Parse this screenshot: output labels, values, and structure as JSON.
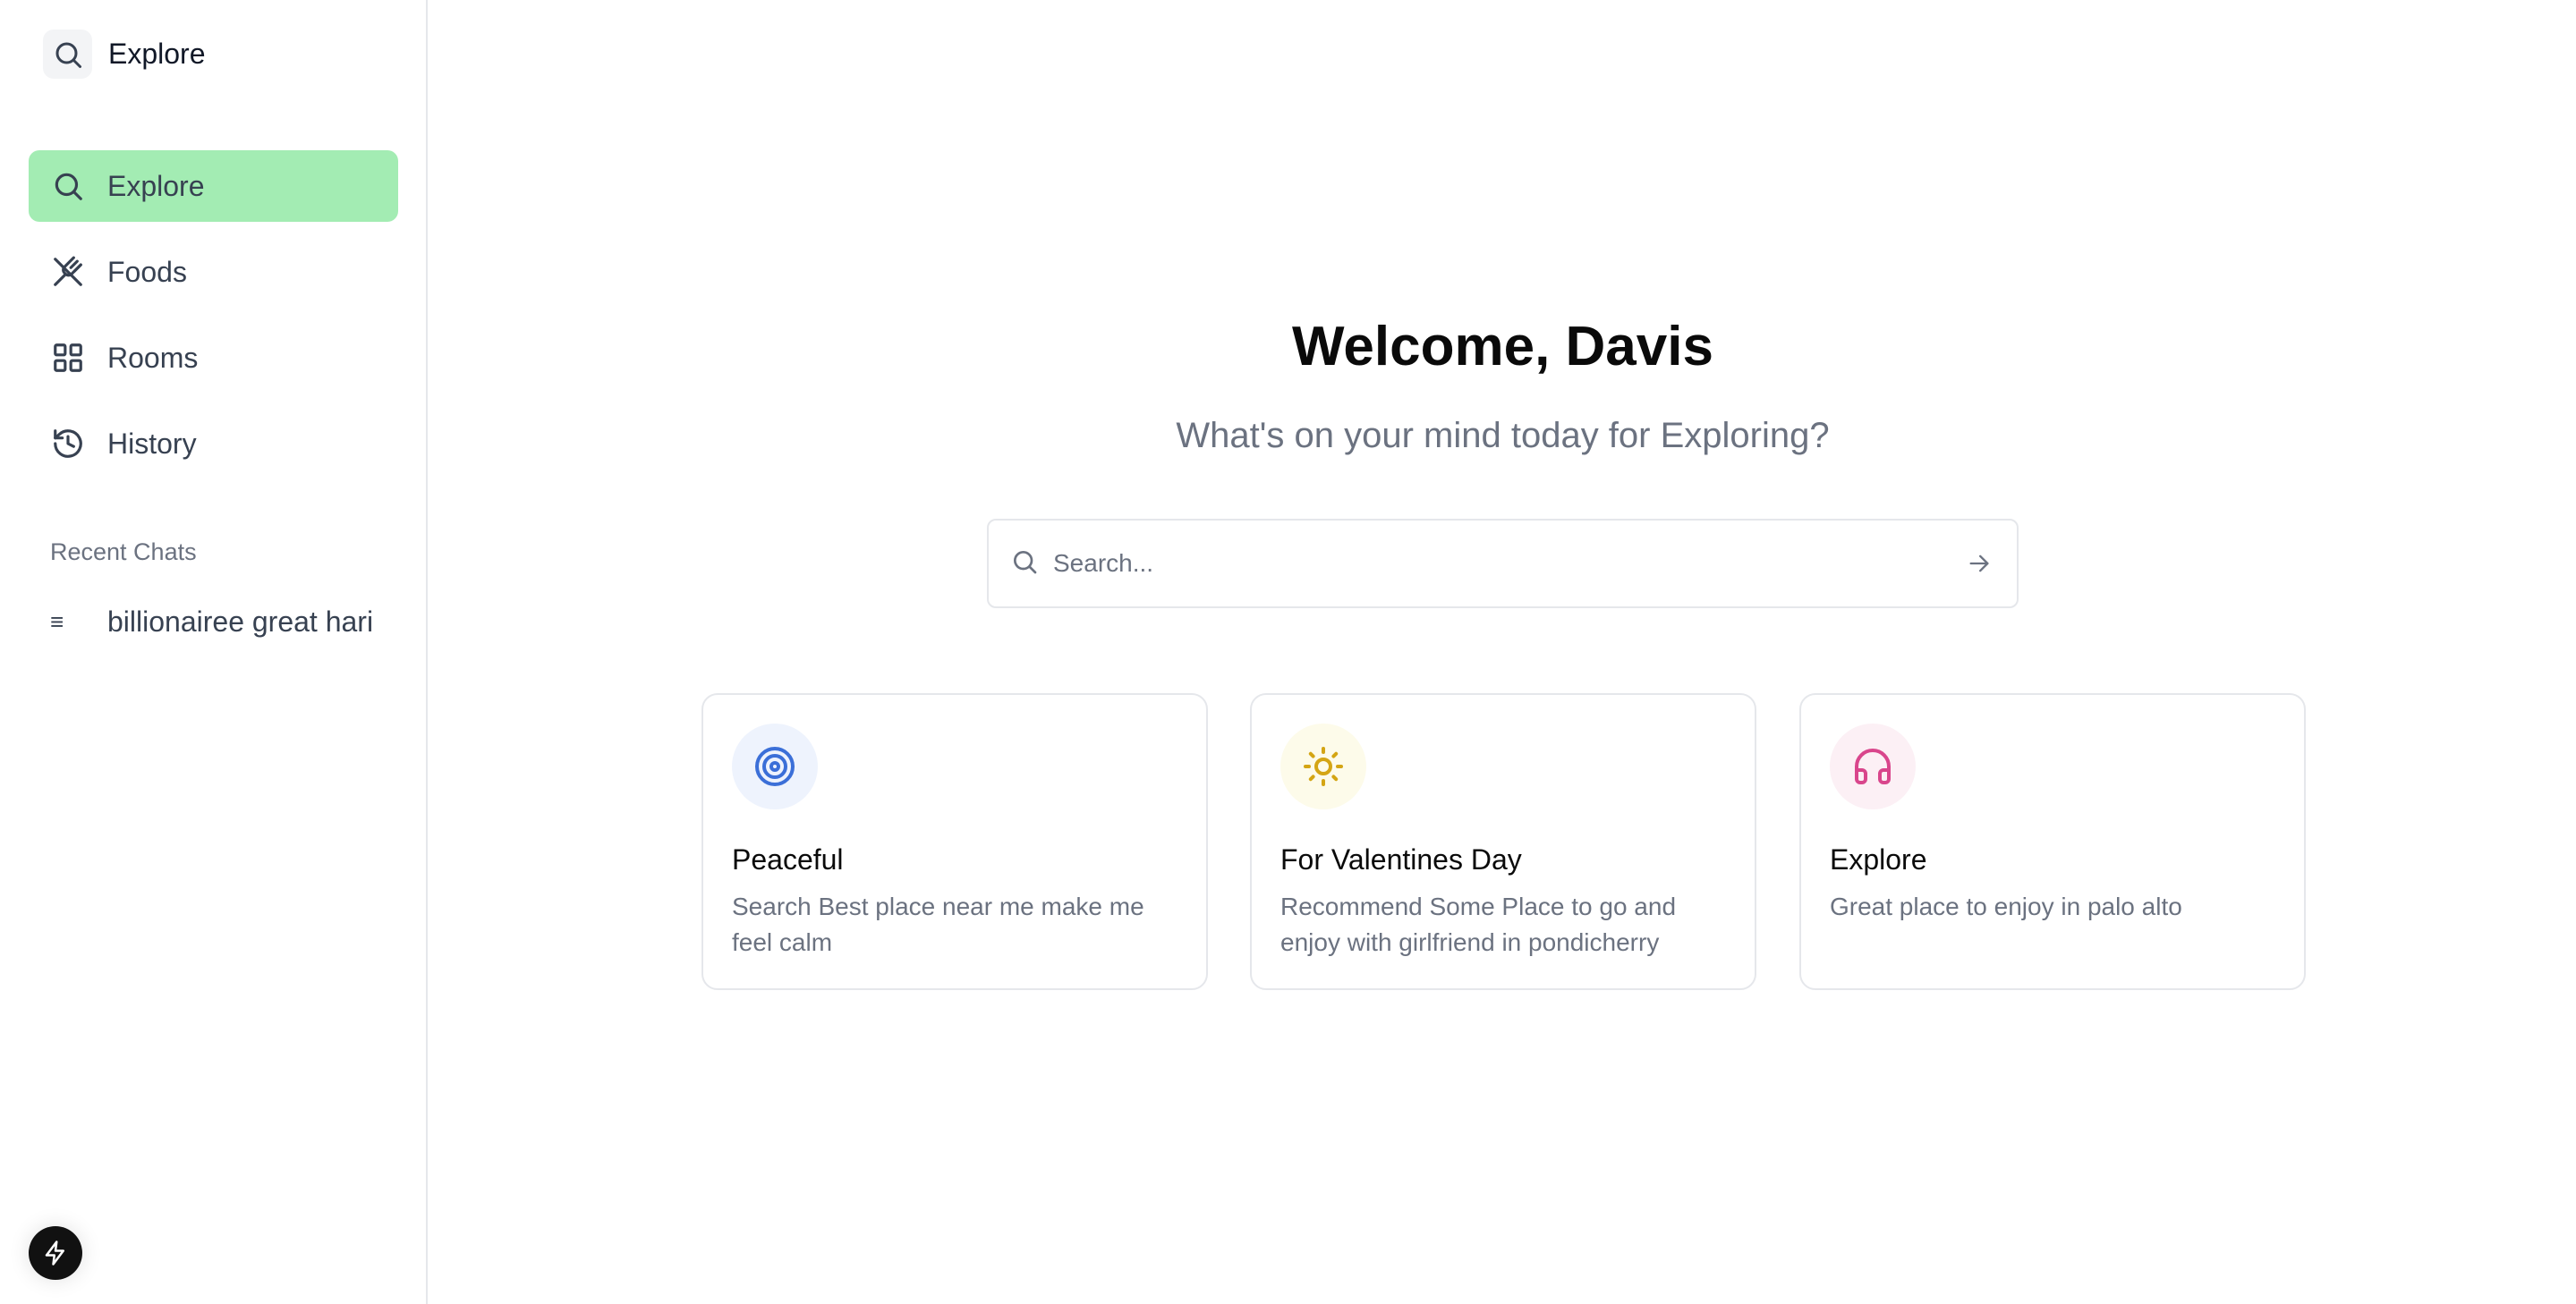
{
  "sidebar": {
    "brand_label": "Explore",
    "nav": [
      {
        "label": "Explore",
        "icon": "search-icon",
        "active": true
      },
      {
        "label": "Foods",
        "icon": "utensils-icon",
        "active": false
      },
      {
        "label": "Rooms",
        "icon": "grid-icon",
        "active": false
      },
      {
        "label": "History",
        "icon": "history-icon",
        "active": false
      }
    ],
    "recent_title": "Recent Chats",
    "recent": [
      {
        "glyph": "≡",
        "label": "billionairee great hari"
      }
    ]
  },
  "main": {
    "heading": "Welcome, Davis",
    "subheading": "What's on your mind today for Exploring?",
    "search": {
      "placeholder": "Search..."
    },
    "cards": [
      {
        "title": "Peaceful",
        "description": "Search Best place near me make me feel calm",
        "icon": "target-icon",
        "accent": "#3b6fd8",
        "bg": "#eef3fd"
      },
      {
        "title": "For Valentines Day",
        "description": "Recommend Some Place to go and enjoy with girlfriend in pondicherry",
        "icon": "sun-icon",
        "accent": "#d4a514",
        "bg": "#fdfbea"
      },
      {
        "title": "Explore",
        "description": "Great place to enjoy in palo alto",
        "icon": "headphones-icon",
        "accent": "#d9468c",
        "bg": "#fcf0f5"
      }
    ]
  },
  "colors": {
    "active_nav_bg": "#a3ecb3",
    "border": "#e5e7eb",
    "muted_text": "#6b7280"
  }
}
